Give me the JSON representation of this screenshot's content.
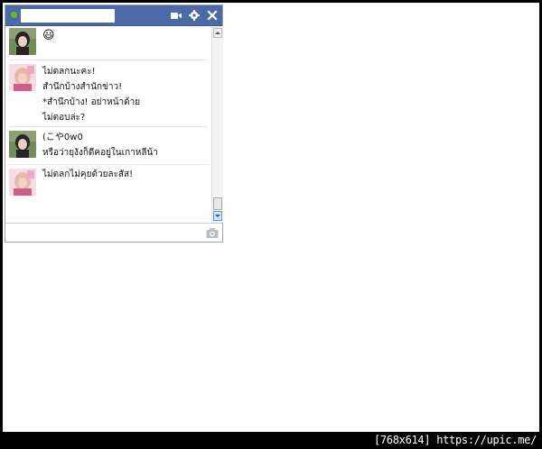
{
  "chat": {
    "status_color": "#5cbf2a",
    "title_bar_color": "#4d6aa8",
    "icons": [
      "video-call-icon",
      "gear-icon",
      "close-icon"
    ],
    "messages": [
      {
        "sender": "a",
        "lines": [
          "😃"
        ]
      },
      {
        "sender": "b",
        "lines": [
          "ไม่ตลกนะคะ!",
          "สำนึกบ้างสำนักข่าว!",
          "*สำนึกบ้าง! อย่าหน้าด้าย",
          "ไม่ตอบล่ะ?"
        ]
      },
      {
        "sender": "a",
        "lines": [
          "(こや0w0",
          "หรือว่ายุงังก็ดีคอยู่ในเกาหลีน้า"
        ]
      },
      {
        "sender": "b",
        "lines": [
          "ไม่ตลกไม่คุยด้วยละสัส!"
        ]
      }
    ],
    "composer": {
      "value": "",
      "placeholder": ""
    }
  },
  "footer": {
    "text": "[768x614] https://upic.me/"
  }
}
